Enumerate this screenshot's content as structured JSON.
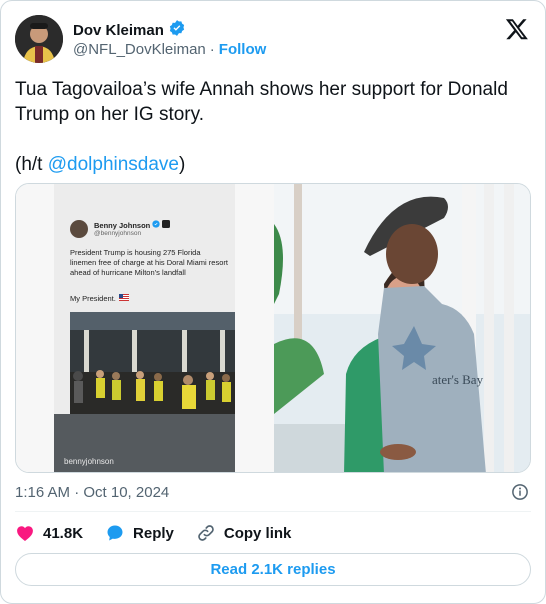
{
  "author": {
    "display_name": "Dov Kleiman",
    "handle": "@NFL_DovKleiman",
    "separator": "·",
    "follow_label": "Follow",
    "verified": true,
    "avatar_icon": "profile-photo"
  },
  "platform_icon": "x-logo-icon",
  "tweet": {
    "line1": "Tua Tagovailoa’s wife Annah shows her support for Donald Trump on her IG story.",
    "prefix": "(h/t ",
    "mention": "@dolphinsdave",
    "suffix": ")"
  },
  "media": {
    "story": {
      "inner_name": "Benny Johnson",
      "inner_handle": "@bennyjohnson",
      "inner_text": "President Trump is housing 275 Florida linemen free of charge at his Doral Miami resort ahead of hurricane Milton’s landfall",
      "inner_text2": "My President.",
      "story_handle": "bennyjohnson"
    },
    "photo": {
      "shirt_text": "ater's Bay"
    }
  },
  "timestamp": "1:16 AM · Oct 10, 2024",
  "actions": {
    "likes_count": "41.8K",
    "reply_label": "Reply",
    "copy_link_label": "Copy link"
  },
  "read_replies_label": "Read 2.1K replies",
  "colors": {
    "accent": "#1d9bf0",
    "like": "#f91880",
    "text": "#0f1419",
    "muted": "#536471"
  }
}
